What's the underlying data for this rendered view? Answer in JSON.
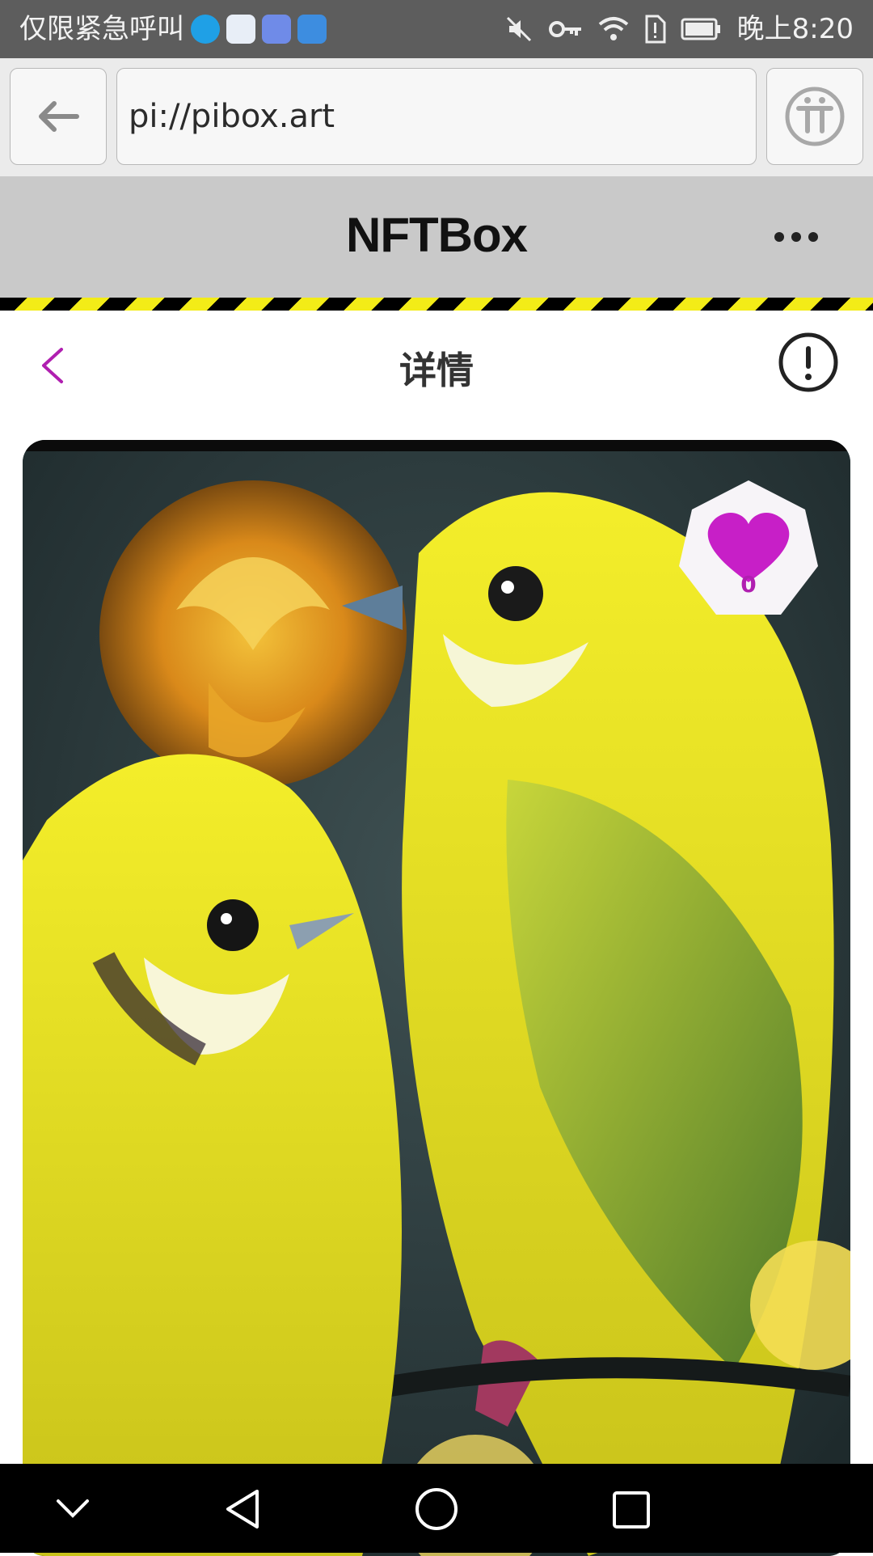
{
  "status_bar": {
    "carrier_text": "仅限紧急呼叫",
    "time": "晚上8:20",
    "icons": [
      "weibo-icon",
      "app-icon",
      "music-icon",
      "browser-icon",
      "mute-icon",
      "key-icon",
      "wifi-icon",
      "sim-alert-icon",
      "battery-icon"
    ]
  },
  "browser": {
    "url": "pi://pibox.art",
    "back_icon": "arrow-left-icon",
    "pi_icon": "pi-logo-icon"
  },
  "app_header": {
    "title": "NFTBox",
    "more_icon": "more-dots-icon"
  },
  "detail": {
    "title": "详情",
    "back_icon": "chevron-left-icon",
    "info_icon": "info-exclamation-icon"
  },
  "artwork": {
    "like_count": "0",
    "like_icon": "heart-icon"
  },
  "colors": {
    "accent": "#b01fb0",
    "header_bg": "#c9c9c9",
    "hazard_yellow": "#f3ec17"
  },
  "nav_bar": {
    "icons": [
      "chevron-down-icon",
      "back-triangle-icon",
      "home-circle-icon",
      "recents-square-icon"
    ]
  }
}
